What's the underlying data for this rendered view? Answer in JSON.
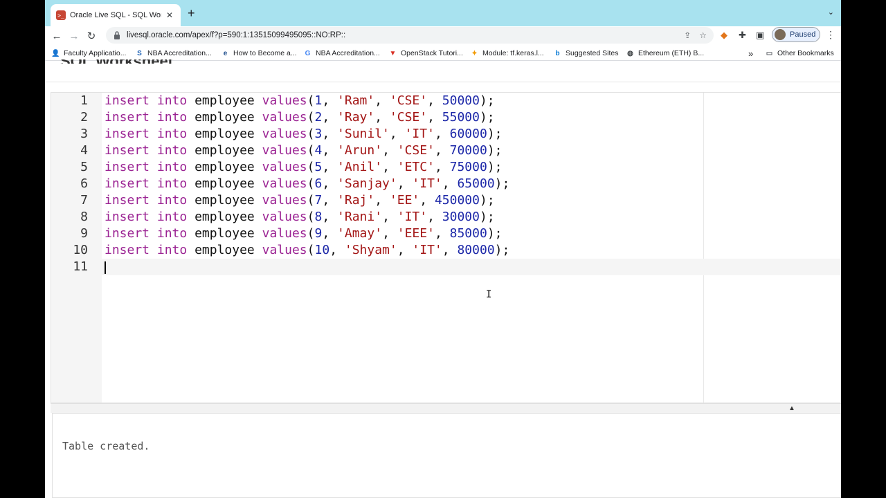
{
  "browser": {
    "tab_title": "Oracle Live SQL - SQL Worksh",
    "tab_close": "✕",
    "new_tab": "+",
    "tab_menu": "⌄",
    "url": "livesql.oracle.com/apex/f?p=590:1:13515099495095::NO:RP::",
    "profile_status": "Paused",
    "icons": [
      "back-icon",
      "forward-icon",
      "reload-icon",
      "lock-icon",
      "share-icon",
      "star-icon",
      "fox-extension-icon",
      "puzzle-extensions-icon",
      "sidepanel-icon",
      "menu-icon"
    ]
  },
  "bookmarks": [
    {
      "label": "Faculty Applicatio...",
      "icon": "👤",
      "color": "#5f6368"
    },
    {
      "label": "NBA Accreditation...",
      "icon": "S",
      "color": "#1a5fb4"
    },
    {
      "label": "How to Become a...",
      "icon": "e",
      "color": "#1f4e8c"
    },
    {
      "label": "NBA Accreditation...",
      "icon": "G",
      "color": "#4285f4"
    },
    {
      "label": "OpenStack Tutori...",
      "icon": "▼",
      "color": "#d93025"
    },
    {
      "label": "Module: tf.keras.l...",
      "icon": "✦",
      "color": "#f29900"
    },
    {
      "label": "Suggested Sites",
      "icon": "b",
      "color": "#0b7bd5"
    },
    {
      "label": "Ethereum (ETH) B...",
      "icon": "◍",
      "color": "#3c4043"
    }
  ],
  "bookmarks_overflow": "»",
  "other_bookmarks": "Other Bookmarks",
  "page_heading": "SQL Worksheet",
  "editor": {
    "lines": [
      {
        "n": "1",
        "id": "1",
        "name": "Ram",
        "dept": "CSE",
        "salary": "50000"
      },
      {
        "n": "2",
        "id": "2",
        "name": "Ray",
        "dept": "CSE",
        "salary": "55000"
      },
      {
        "n": "3",
        "id": "3",
        "name": "Sunil",
        "dept": "IT",
        "salary": "60000"
      },
      {
        "n": "4",
        "id": "4",
        "name": "Arun",
        "dept": "CSE",
        "salary": "70000"
      },
      {
        "n": "5",
        "id": "5",
        "name": "Anil",
        "dept": "ETC",
        "salary": "75000"
      },
      {
        "n": "6",
        "id": "6",
        "name": "Sanjay",
        "dept": "IT",
        "salary": "65000"
      },
      {
        "n": "7",
        "id": "7",
        "name": "Raj",
        "dept": "EE",
        "salary": "450000"
      },
      {
        "n": "8",
        "id": "8",
        "name": "Rani",
        "dept": "IT",
        "salary": "30000"
      },
      {
        "n": "9",
        "id": "9",
        "name": "Amay",
        "dept": "EEE",
        "salary": "85000"
      },
      {
        "n": "10",
        "id": "10",
        "name": "Shyam",
        "dept": "IT",
        "salary": "80000"
      }
    ],
    "empty_line_number": "11",
    "kw_insert": "insert",
    "kw_into": "into",
    "table": "employee",
    "kw_values": "values"
  },
  "results": {
    "message": "Table created."
  }
}
